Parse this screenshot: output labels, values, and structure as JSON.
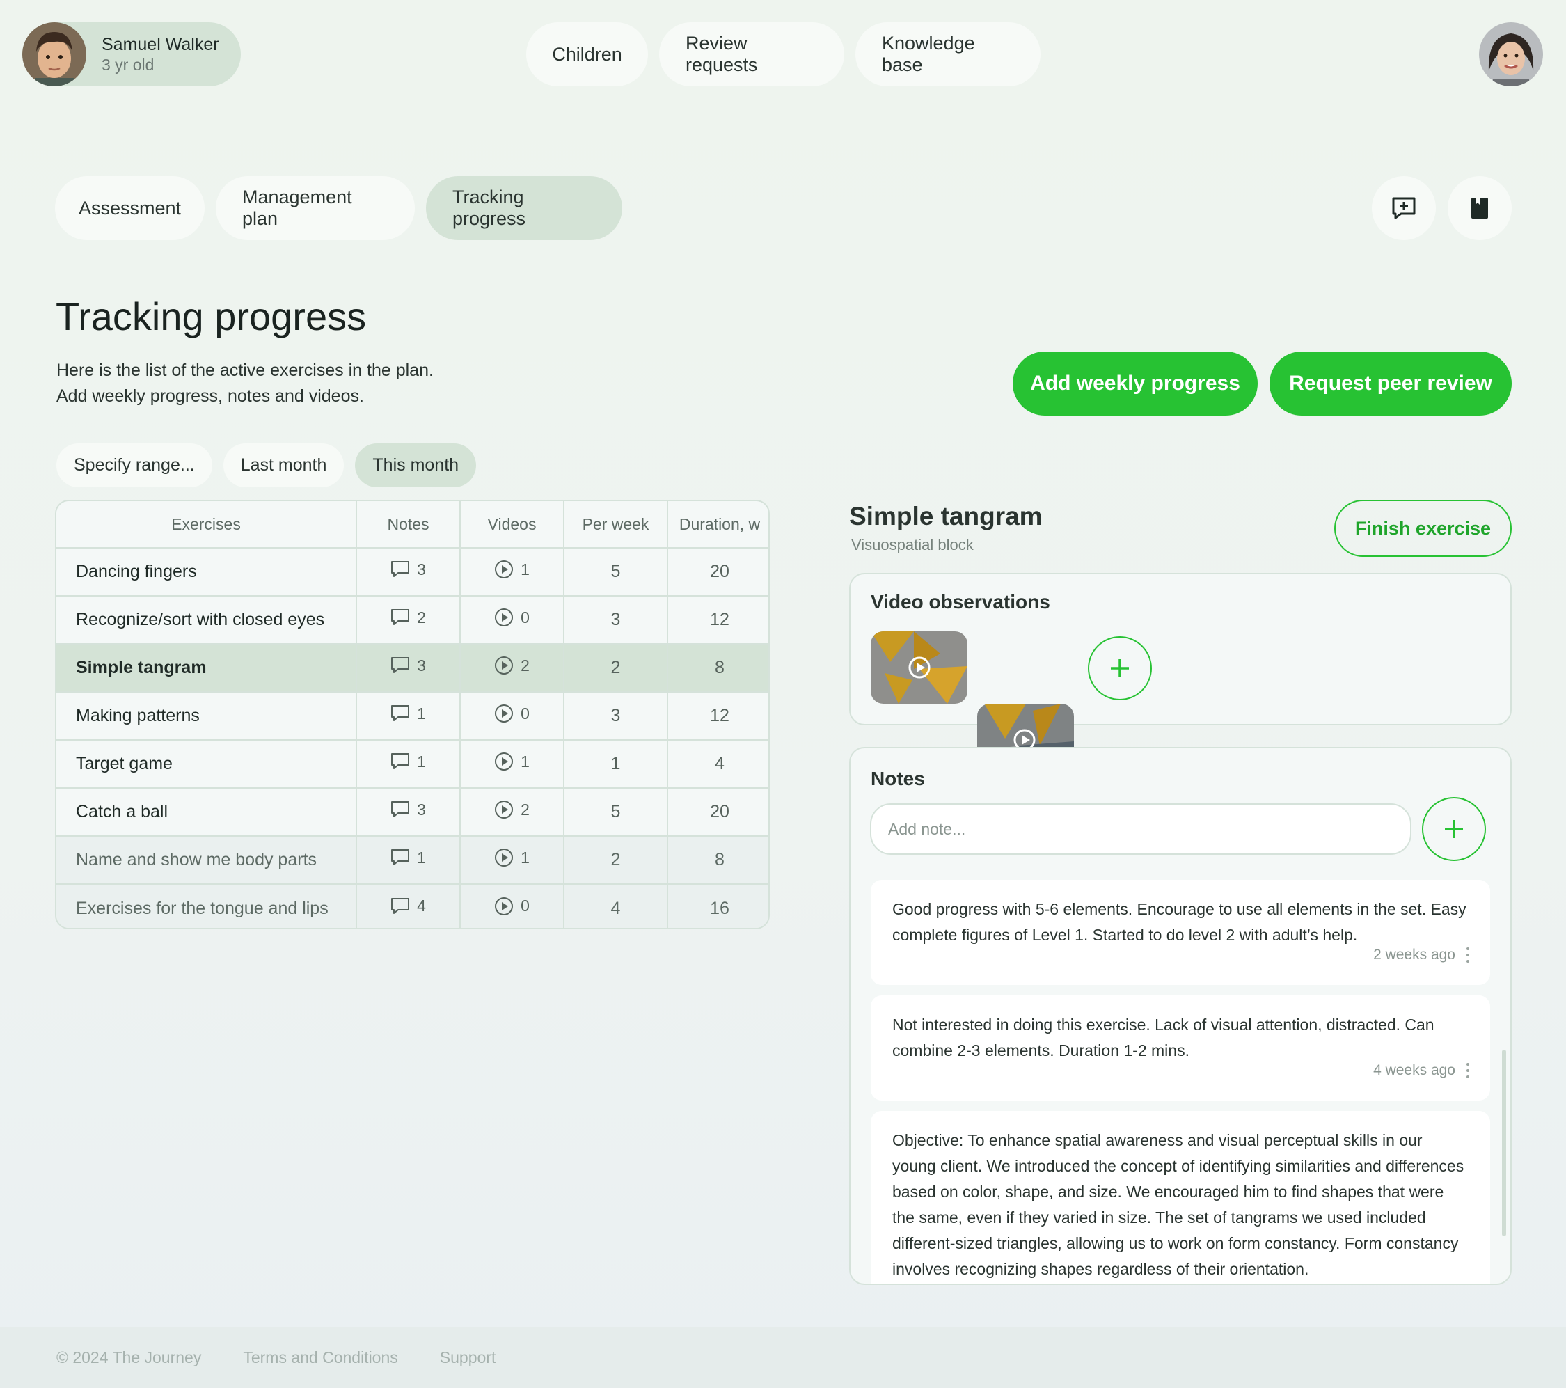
{
  "child": {
    "name": "Samuel Walker",
    "age": "3 yr old"
  },
  "topnav": [
    "Children",
    "Review requests",
    "Knowledge base"
  ],
  "subtabs": [
    "Assessment",
    "Management plan",
    "Tracking progress"
  ],
  "page": {
    "title": "Tracking progress",
    "desc_line1": "Here is the list of the active exercises in the plan.",
    "desc_line2": "Add weekly progress, notes and videos.",
    "add_weekly": "Add weekly progress",
    "request_review": "Request peer review"
  },
  "range": [
    "Specify range...",
    "Last month",
    "This month"
  ],
  "table": {
    "headers": [
      "Exercises",
      "Notes",
      "Videos",
      "Per week",
      "Duration, w"
    ],
    "rows": [
      {
        "name": "Dancing fingers",
        "notes": "3",
        "videos": "1",
        "per_week": "5",
        "duration": "20"
      },
      {
        "name": "Recognize/sort with closed eyes",
        "notes": "2",
        "videos": "0",
        "per_week": "3",
        "duration": "12"
      },
      {
        "name": "Simple tangram",
        "notes": "3",
        "videos": "2",
        "per_week": "2",
        "duration": "8"
      },
      {
        "name": "Making patterns",
        "notes": "1",
        "videos": "0",
        "per_week": "3",
        "duration": "12"
      },
      {
        "name": "Target game",
        "notes": "1",
        "videos": "1",
        "per_week": "1",
        "duration": "4"
      },
      {
        "name": "Catch a ball",
        "notes": "3",
        "videos": "2",
        "per_week": "5",
        "duration": "20"
      },
      {
        "name": "Name and show me body parts",
        "notes": "1",
        "videos": "1",
        "per_week": "2",
        "duration": "8"
      },
      {
        "name": "Exercises for the tongue and lips",
        "notes": "4",
        "videos": "0",
        "per_week": "4",
        "duration": "16"
      }
    ]
  },
  "detail": {
    "title": "Simple tangram",
    "subtitle": "Visuospatial block",
    "finish": "Finish exercise",
    "video_title": "Video observations",
    "notes_title": "Notes",
    "note_placeholder": "Add note...",
    "notes": [
      {
        "text": "Good progress with 5-6 elements. Encourage to use all elements in the set. Easy complete figures of Level 1. Started to do level 2 with adult’s help.",
        "time": "2 weeks ago"
      },
      {
        "text": "Not interested in doing this exercise. Lack of visual attention, distracted. Can combine 2-3 elements. Duration 1-2 mins.",
        "time": "4 weeks ago"
      },
      {
        "text": "Objective: To enhance spatial awareness and visual perceptual skills in our young client. We introduced the concept of identifying similarities and differences based on color, shape, and size. We encouraged him to find shapes that were the same, even if they varied in size. The set of tangrams we used included different-sized triangles, allowing us to work on form constancy. Form constancy involves recognizing shapes regardless of their orientation.",
        "time": ""
      }
    ]
  },
  "footer": {
    "copyright": "© 2024 The Journey",
    "terms": "Terms and Conditions",
    "support": "Support"
  },
  "colors": {
    "accent": "#27c233",
    "selected": "#d4e3d6",
    "pill": "#f7faf7"
  }
}
